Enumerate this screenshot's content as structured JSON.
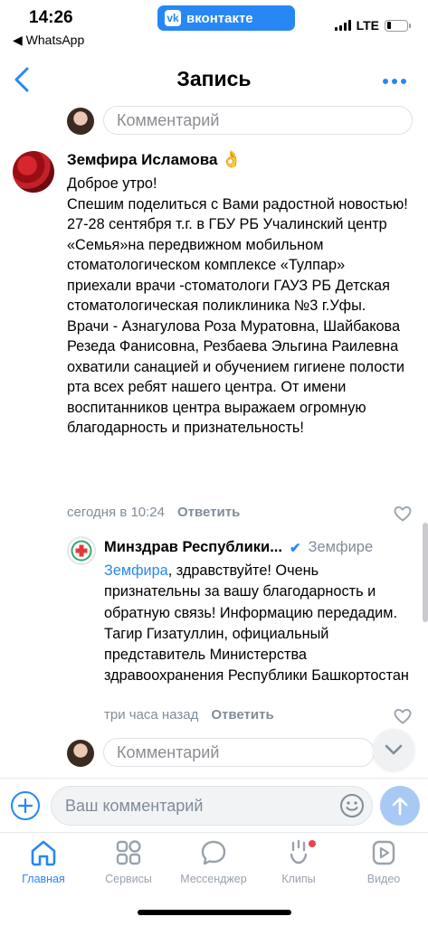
{
  "status_bar": {
    "time": "14:26",
    "back_app": "◀ WhatsApp",
    "badge_text": "вконтакте",
    "network": "LTE"
  },
  "nav": {
    "title": "Запись"
  },
  "top_comment_input": {
    "placeholder": "Комментарий"
  },
  "comment": {
    "author": "Земфира Исламова",
    "author_emoji": "👌",
    "text": "Доброе утро!\nСпешим поделиться с Вами радостной новостью!\n27-28 сентября т.г. в ГБУ РБ Учалинский центр «Семья»на передвижном мобильном стоматологическом комплексе «Тулпар» приехали врачи -стоматологи ГАУЗ РБ Детская стоматологическая поликлиника №3 г.Уфы.\nВрачи - Азнагулова Роза Муратовна, Шайбакова Резеда Фанисовна, Резбаева Эльгина Раилевна охватили санацией и обучением гигиене полости рта всех ребят нашего центра. От имени воспитанников центра выражаем огромную благодарность и признательность!",
    "time": "сегодня в 10:24",
    "reply_label": "Ответить"
  },
  "reply": {
    "author": "Минздрав Республики...",
    "reply_to": "Земфире",
    "mention": "Земфира",
    "text": ", здравствуйте! Очень признательны за вашу благодарность и обратную связь! Информацию передадим. Тагир Гизатуллин, официальный представитель Министерства здравоохранения Республики Башкортостан",
    "time": "три часа назад",
    "reply_label": "Ответить"
  },
  "bottom_comment_input": {
    "placeholder": "Комментарий"
  },
  "composer": {
    "placeholder": "Ваш комментарий"
  },
  "tabs": [
    {
      "label": "Главная",
      "icon": "home-icon",
      "active": true
    },
    {
      "label": "Сервисы",
      "icon": "services-icon",
      "active": false
    },
    {
      "label": "Мессенджер",
      "icon": "messenger-icon",
      "active": false
    },
    {
      "label": "Клипы",
      "icon": "clips-icon",
      "active": false
    },
    {
      "label": "Видео",
      "icon": "video-icon",
      "active": false
    }
  ],
  "colors": {
    "accent": "#2787f5",
    "muted": "#818c99"
  }
}
